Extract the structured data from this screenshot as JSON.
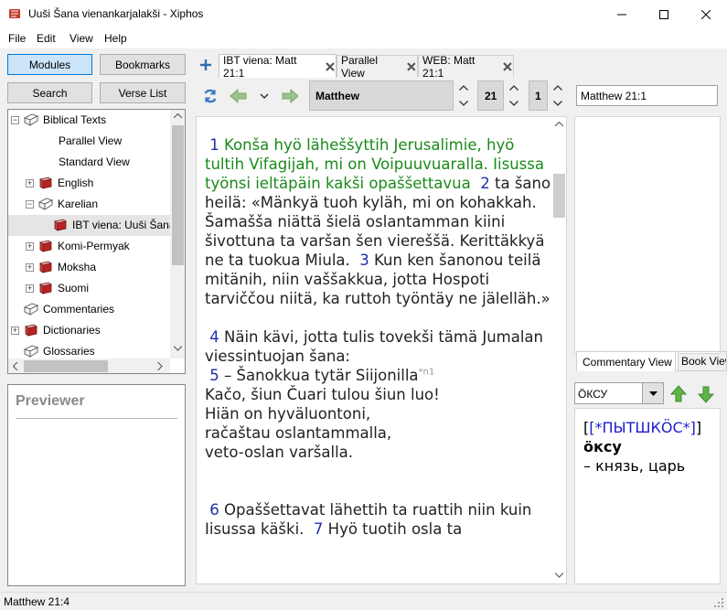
{
  "window": {
    "title": "Uuši Šana vienankarjalakši - Xiphos"
  },
  "menu": [
    "File",
    "Edit",
    "View",
    "Help"
  ],
  "left": {
    "modules_btn": "Modules",
    "bookmarks_btn": "Bookmarks",
    "search_btn": "Search",
    "verselist_btn": "Verse List",
    "tree": [
      {
        "label": "Biblical Texts",
        "level": 0,
        "expander": "−",
        "icon": "open-book-icon"
      },
      {
        "label": "Parallel View",
        "level": 1,
        "expander": "",
        "icon": ""
      },
      {
        "label": "Standard View",
        "level": 1,
        "expander": "",
        "icon": ""
      },
      {
        "label": "English",
        "level": 1,
        "expander": "+",
        "icon": "book-icon"
      },
      {
        "label": "Karelian",
        "level": 1,
        "expander": "−",
        "icon": "open-book-icon"
      },
      {
        "label": "IBT viena: Uuši Šana",
        "level": 2,
        "expander": "",
        "icon": "book-icon"
      },
      {
        "label": "Komi-Permyak",
        "level": 1,
        "expander": "+",
        "icon": "book-icon"
      },
      {
        "label": "Moksha",
        "level": 1,
        "expander": "+",
        "icon": "book-icon"
      },
      {
        "label": "Suomi",
        "level": 1,
        "expander": "+",
        "icon": "book-icon"
      },
      {
        "label": "Commentaries",
        "level": 0,
        "expander": "",
        "icon": "open-book-icon"
      },
      {
        "label": "Dictionaries",
        "level": 0,
        "expander": "+",
        "icon": "book-icon"
      },
      {
        "label": "Glossaries",
        "level": 0,
        "expander": "",
        "icon": "open-book-icon"
      }
    ],
    "previewer_title": "Previewer"
  },
  "tabs": [
    {
      "label": "IBT viena: Matt 21:1"
    },
    {
      "label": "Parallel View"
    },
    {
      "label": "WEB: Matt 21:1"
    }
  ],
  "toolbar": {
    "book": "Matthew",
    "chapter": "21",
    "verse": "1",
    "reference": "Matthew 21:1"
  },
  "text": {
    "v1n": "1",
    "v1": "Konša hyö läheššyttih Jerusalimie, hyö tultih Vifagijah, mi on Voipuuvuaralla. Iisussa työnsi ieltäpäin kakši opaššettavua",
    "v2n": "2",
    "v2": "ta šano heilä: «Mänkyä tuoh kyläh, mi on kohakkah. Šamašša niättä šielä oslantamman kiini šivottuna ta varšan šen viereššä. Kerittäkkyä ne ta tuokua Miula.",
    "v3n": "3",
    "v3": "Kun ken šanonou teilä mitänih, niin vaššakkua, jotta Hospoti tarviččou niitä, ka ruttoh työntäy ne jälelläh.»",
    "v4n": "4",
    "v4": "Näin kävi, jotta tulis tovekši tämä Jumalan viessintuojan šana:",
    "v5n": "5",
    "v5a": "– Šanokkua tytär Siijonilla",
    "v5fn": "*n1",
    "v5l1": "Kačo, šiun Čuari tulou šiun luo!",
    "v5l2": "Hiän on hyväluontoni,",
    "v5l3": "račaštau oslantammalla,",
    "v5l4": "veto-oslan varšalla.",
    "v6n": "6",
    "v6": "Opaššettavat lähettih ta ruattih niin kuin Iisussa käški.",
    "v7n": "7",
    "v7": "Hyö tuotih osla ta"
  },
  "right": {
    "tab_commentary": "Commentary View",
    "tab_book": "Book View",
    "dict_key": "ÖКСУ",
    "dict_head": "[*ПЫТШКӦС*]",
    "dict_word": "öксу",
    "dict_def": "– князь, царь"
  },
  "status": "Matthew 21:4",
  "colors": {
    "accent": "#0078d7",
    "verse_number": "#1f2ea8",
    "red_letter": "#1a8a1a",
    "link": "#1c1ccf"
  }
}
